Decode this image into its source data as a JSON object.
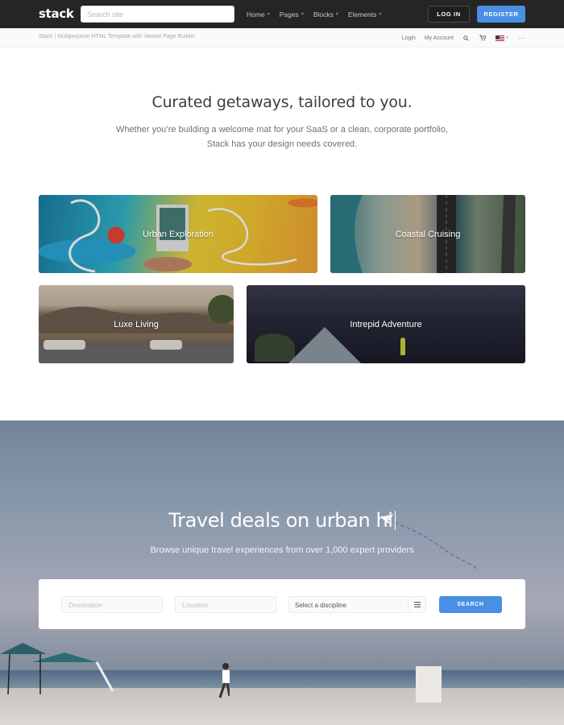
{
  "colors": {
    "nav_bg": "#252525",
    "accent": "#4a90e2",
    "text": "#555555"
  },
  "nav": {
    "logo": "stack",
    "search_placeholder": "Search site",
    "menu": [
      {
        "label": "Home"
      },
      {
        "label": "Pages"
      },
      {
        "label": "Blocks"
      },
      {
        "label": "Elements"
      }
    ],
    "login_label": "LOG IN",
    "register_label": "REGISTER"
  },
  "subbar": {
    "title": "Stack | Multipurpose HTML Template with Variant Page Builder",
    "login": "Login",
    "account": "My Account",
    "icons": [
      "search-icon",
      "cart-icon",
      "us-flag-icon",
      "more-icon"
    ]
  },
  "intro": {
    "heading": "Curated getaways, tailored to you.",
    "lead_line1": "Whether you’re building a welcome mat for your SaaS or a clean, corporate portfolio,",
    "lead_line2": "Stack has your design needs covered."
  },
  "cards": [
    {
      "label": "Urban Exploration"
    },
    {
      "label": "Coastal Cruising"
    },
    {
      "label": "Luxe Living"
    },
    {
      "label": "Intrepid Adventure"
    }
  ],
  "hero": {
    "heading": "Travel deals on urban hi",
    "subheading": "Browse unique travel experiences from over 1,000 expert providers",
    "destination_placeholder": "Destination",
    "location_placeholder": "Location",
    "select_label": "Select a discipline",
    "search_button": "SEARCH"
  }
}
